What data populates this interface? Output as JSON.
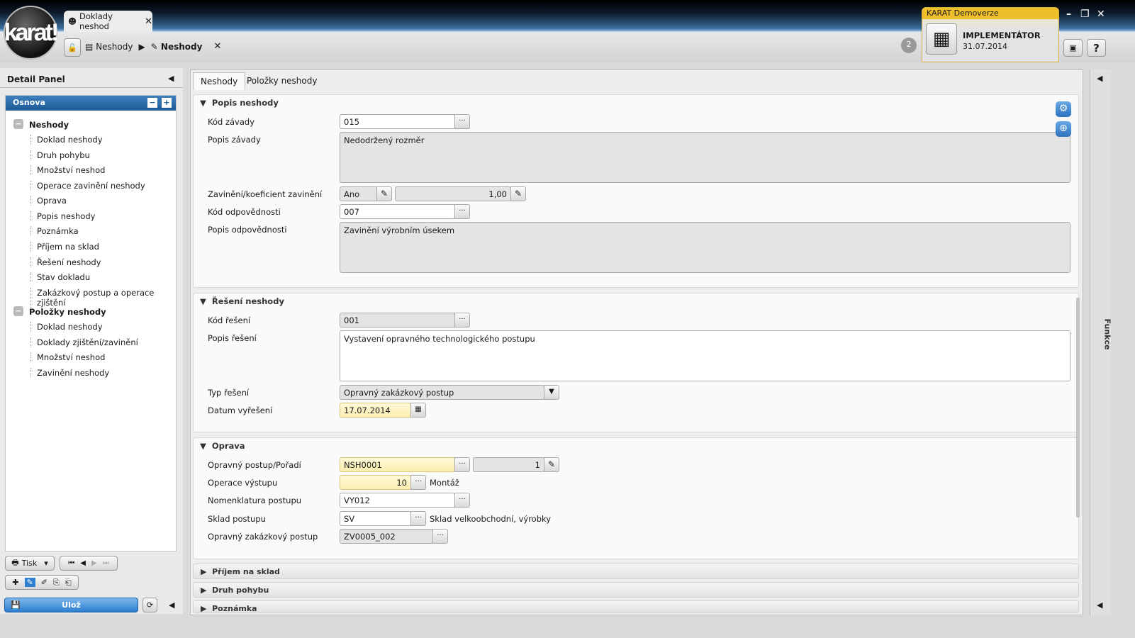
{
  "app": {
    "logo": "karat!",
    "doc_tab": "Doklady neshod",
    "breadcrumb": [
      "Neshody",
      "Neshody"
    ],
    "notification_count": "2",
    "demo_label": "KARAT Demoverze",
    "user_role": "IMPLEMENTÁTOR",
    "date": "31.07.2014"
  },
  "left_panel": {
    "title": "Detail Panel",
    "outline_title": "Osnova",
    "groups": [
      {
        "label": "Neshody",
        "items": [
          "Doklad neshody",
          "Druh pohybu",
          "Množství neshod",
          "Operace zavinění neshody",
          "Oprava",
          "Popis neshody",
          "Poznámka",
          "Příjem na sklad",
          "Řešení neshody",
          "Stav dokladu",
          "Zakázkový postup a operace zjištění"
        ]
      },
      {
        "label": "Položky neshody",
        "items": [
          "Doklad neshody",
          "Doklady zjištění/zavinění",
          "Množství neshod",
          "Zavinění neshody"
        ]
      }
    ],
    "print_label": "Tisk",
    "save_label": "Ulož"
  },
  "tabs": [
    "Neshody",
    "Položky neshody"
  ],
  "right_panel": {
    "label": "Funkce"
  },
  "sections": {
    "popis": {
      "title": "Popis neshody",
      "kod_zavady_label": "Kód závady",
      "kod_zavady": "015",
      "popis_zavady_label": "Popis závady",
      "popis_zavady": "Nedodržený rozměr",
      "zavineni_label": "Zavinění/koeficient zavinění",
      "zavineni": "Ano",
      "koeficient": "1,00",
      "kod_odp_label": "Kód odpovědnosti",
      "kod_odp": "007",
      "popis_odp_label": "Popis odpovědnosti",
      "popis_odp": "Zavinění výrobním úsekem"
    },
    "reseni": {
      "title": "Řešení neshody",
      "kod_label": "Kód řešení",
      "kod": "001",
      "popis_label": "Popis řešení",
      "popis": "Vystavení opravného technologického postupu",
      "typ_label": "Typ řešení",
      "typ": "Opravný zakázkový postup",
      "datum_label": "Datum vyřešení",
      "datum": "17.07.2014"
    },
    "oprava": {
      "title": "Oprava",
      "postup_label": "Opravný postup/Pořadí",
      "postup": "NSH0001",
      "poradi": "1",
      "operace_label": "Operace výstupu",
      "operace": "10",
      "operace_name": "Montáž",
      "nomen_label": "Nomenklatura postupu",
      "nomen": "VY012",
      "sklad_label": "Sklad postupu",
      "sklad": "SV",
      "sklad_name": "Sklad velkoobchodní, výrobky",
      "zak_label": "Opravný zakázkový postup",
      "zak": "ZV0005_002"
    },
    "collapsed": [
      "Příjem na sklad",
      "Druh pohybu",
      "Poznámka"
    ]
  }
}
